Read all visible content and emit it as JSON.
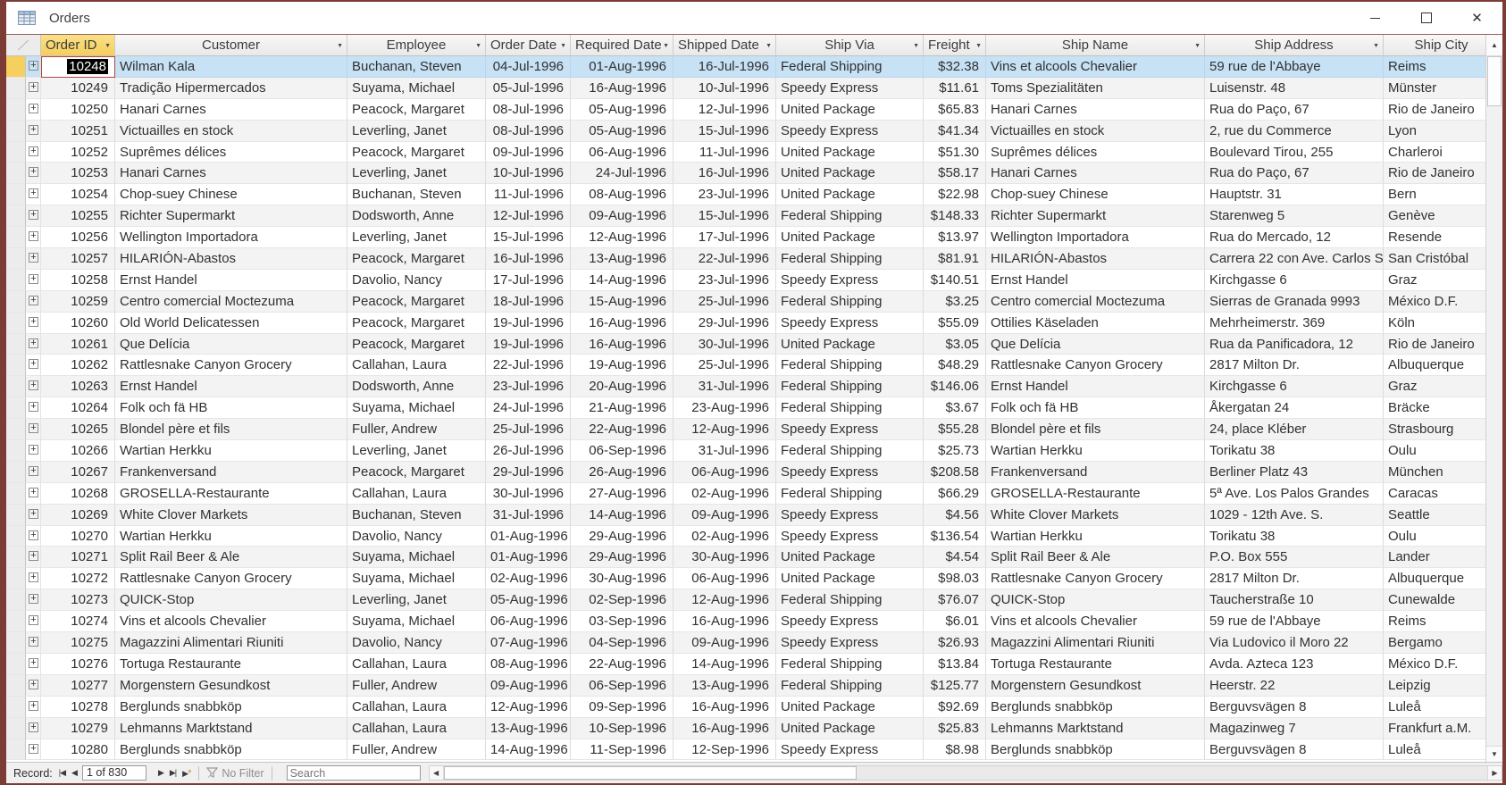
{
  "window": {
    "title": "Orders"
  },
  "icons": {
    "close": "✕",
    "scroll_up": "▲",
    "scroll_down": "▼",
    "scroll_left": "◀",
    "scroll_right": "▶",
    "first": "|◀",
    "previous": "◀",
    "next": "▶",
    "last": "▶|",
    "star": "*",
    "expand_row": "+",
    "header_menu_arrow": "▼"
  },
  "navbar": {
    "record_label": "Record:",
    "position": "1 of 830",
    "no_filter_label": "No Filter",
    "search_placeholder": "Search"
  },
  "table": {
    "columns": [
      {
        "key": "order_id",
        "label": "Order ID"
      },
      {
        "key": "customer",
        "label": "Customer"
      },
      {
        "key": "employee",
        "label": "Employee"
      },
      {
        "key": "order_date",
        "label": "Order Date"
      },
      {
        "key": "required_date",
        "label": "Required Date"
      },
      {
        "key": "shipped_date",
        "label": "Shipped Date"
      },
      {
        "key": "ship_via",
        "label": "Ship Via"
      },
      {
        "key": "freight",
        "label": "Freight"
      },
      {
        "key": "ship_name",
        "label": "Ship Name"
      },
      {
        "key": "ship_address",
        "label": "Ship Address"
      },
      {
        "key": "ship_city",
        "label": "Ship City"
      }
    ],
    "selection": {
      "row_index": 0,
      "column": "order_id",
      "value": "10248"
    },
    "rows": [
      [
        "10248",
        "Wilman Kala",
        "Buchanan, Steven",
        "04-Jul-1996",
        "01-Aug-1996",
        "16-Jul-1996",
        "Federal Shipping",
        "$32.38",
        "Vins et alcools Chevalier",
        "59 rue de l'Abbaye",
        "Reims"
      ],
      [
        "10249",
        "Tradição Hipermercados",
        "Suyama, Michael",
        "05-Jul-1996",
        "16-Aug-1996",
        "10-Jul-1996",
        "Speedy Express",
        "$11.61",
        "Toms Spezialitäten",
        "Luisenstr. 48",
        "Münster"
      ],
      [
        "10250",
        "Hanari Carnes",
        "Peacock, Margaret",
        "08-Jul-1996",
        "05-Aug-1996",
        "12-Jul-1996",
        "United Package",
        "$65.83",
        "Hanari Carnes",
        "Rua do Paço, 67",
        "Rio de Janeiro"
      ],
      [
        "10251",
        "Victuailles en stock",
        "Leverling, Janet",
        "08-Jul-1996",
        "05-Aug-1996",
        "15-Jul-1996",
        "Speedy Express",
        "$41.34",
        "Victuailles en stock",
        "2, rue du Commerce",
        "Lyon"
      ],
      [
        "10252",
        "Suprêmes délices",
        "Peacock, Margaret",
        "09-Jul-1996",
        "06-Aug-1996",
        "11-Jul-1996",
        "United Package",
        "$51.30",
        "Suprêmes délices",
        "Boulevard Tirou, 255",
        "Charleroi"
      ],
      [
        "10253",
        "Hanari Carnes",
        "Leverling, Janet",
        "10-Jul-1996",
        "24-Jul-1996",
        "16-Jul-1996",
        "United Package",
        "$58.17",
        "Hanari Carnes",
        "Rua do Paço, 67",
        "Rio de Janeiro"
      ],
      [
        "10254",
        "Chop-suey Chinese",
        "Buchanan, Steven",
        "11-Jul-1996",
        "08-Aug-1996",
        "23-Jul-1996",
        "United Package",
        "$22.98",
        "Chop-suey Chinese",
        "Hauptstr. 31",
        "Bern"
      ],
      [
        "10255",
        "Richter Supermarkt",
        "Dodsworth, Anne",
        "12-Jul-1996",
        "09-Aug-1996",
        "15-Jul-1996",
        "Federal Shipping",
        "$148.33",
        "Richter Supermarkt",
        "Starenweg 5",
        "Genève"
      ],
      [
        "10256",
        "Wellington Importadora",
        "Leverling, Janet",
        "15-Jul-1996",
        "12-Aug-1996",
        "17-Jul-1996",
        "United Package",
        "$13.97",
        "Wellington Importadora",
        "Rua do Mercado, 12",
        "Resende"
      ],
      [
        "10257",
        "HILARIÓN-Abastos",
        "Peacock, Margaret",
        "16-Jul-1996",
        "13-Aug-1996",
        "22-Jul-1996",
        "Federal Shipping",
        "$81.91",
        "HILARIÓN-Abastos",
        "Carrera 22 con Ave. Carlos S",
        "San Cristóbal"
      ],
      [
        "10258",
        "Ernst Handel",
        "Davolio, Nancy",
        "17-Jul-1996",
        "14-Aug-1996",
        "23-Jul-1996",
        "Speedy Express",
        "$140.51",
        "Ernst Handel",
        "Kirchgasse 6",
        "Graz"
      ],
      [
        "10259",
        "Centro comercial Moctezuma",
        "Peacock, Margaret",
        "18-Jul-1996",
        "15-Aug-1996",
        "25-Jul-1996",
        "Federal Shipping",
        "$3.25",
        "Centro comercial Moctezuma",
        "Sierras de Granada 9993",
        "México D.F."
      ],
      [
        "10260",
        "Old World Delicatessen",
        "Peacock, Margaret",
        "19-Jul-1996",
        "16-Aug-1996",
        "29-Jul-1996",
        "Speedy Express",
        "$55.09",
        "Ottilies Käseladen",
        "Mehrheimerstr. 369",
        "Köln"
      ],
      [
        "10261",
        "Que Delícia",
        "Peacock, Margaret",
        "19-Jul-1996",
        "16-Aug-1996",
        "30-Jul-1996",
        "United Package",
        "$3.05",
        "Que Delícia",
        "Rua da Panificadora, 12",
        "Rio de Janeiro"
      ],
      [
        "10262",
        "Rattlesnake Canyon Grocery",
        "Callahan, Laura",
        "22-Jul-1996",
        "19-Aug-1996",
        "25-Jul-1996",
        "Federal Shipping",
        "$48.29",
        "Rattlesnake Canyon Grocery",
        "2817 Milton Dr.",
        "Albuquerque"
      ],
      [
        "10263",
        "Ernst Handel",
        "Dodsworth, Anne",
        "23-Jul-1996",
        "20-Aug-1996",
        "31-Jul-1996",
        "Federal Shipping",
        "$146.06",
        "Ernst Handel",
        "Kirchgasse 6",
        "Graz"
      ],
      [
        "10264",
        "Folk och fä HB",
        "Suyama, Michael",
        "24-Jul-1996",
        "21-Aug-1996",
        "23-Aug-1996",
        "Federal Shipping",
        "$3.67",
        "Folk och fä HB",
        "Åkergatan 24",
        "Bräcke"
      ],
      [
        "10265",
        "Blondel père et fils",
        "Fuller, Andrew",
        "25-Jul-1996",
        "22-Aug-1996",
        "12-Aug-1996",
        "Speedy Express",
        "$55.28",
        "Blondel père et fils",
        "24, place Kléber",
        "Strasbourg"
      ],
      [
        "10266",
        "Wartian Herkku",
        "Leverling, Janet",
        "26-Jul-1996",
        "06-Sep-1996",
        "31-Jul-1996",
        "Federal Shipping",
        "$25.73",
        "Wartian Herkku",
        "Torikatu 38",
        "Oulu"
      ],
      [
        "10267",
        "Frankenversand",
        "Peacock, Margaret",
        "29-Jul-1996",
        "26-Aug-1996",
        "06-Aug-1996",
        "Speedy Express",
        "$208.58",
        "Frankenversand",
        "Berliner Platz 43",
        "München"
      ],
      [
        "10268",
        "GROSELLA-Restaurante",
        "Callahan, Laura",
        "30-Jul-1996",
        "27-Aug-1996",
        "02-Aug-1996",
        "Federal Shipping",
        "$66.29",
        "GROSELLA-Restaurante",
        "5ª Ave. Los Palos Grandes",
        "Caracas"
      ],
      [
        "10269",
        "White Clover Markets",
        "Buchanan, Steven",
        "31-Jul-1996",
        "14-Aug-1996",
        "09-Aug-1996",
        "Speedy Express",
        "$4.56",
        "White Clover Markets",
        "1029 - 12th Ave. S.",
        "Seattle"
      ],
      [
        "10270",
        "Wartian Herkku",
        "Davolio, Nancy",
        "01-Aug-1996",
        "29-Aug-1996",
        "02-Aug-1996",
        "Speedy Express",
        "$136.54",
        "Wartian Herkku",
        "Torikatu 38",
        "Oulu"
      ],
      [
        "10271",
        "Split Rail Beer & Ale",
        "Suyama, Michael",
        "01-Aug-1996",
        "29-Aug-1996",
        "30-Aug-1996",
        "United Package",
        "$4.54",
        "Split Rail Beer & Ale",
        "P.O. Box 555",
        "Lander"
      ],
      [
        "10272",
        "Rattlesnake Canyon Grocery",
        "Suyama, Michael",
        "02-Aug-1996",
        "30-Aug-1996",
        "06-Aug-1996",
        "United Package",
        "$98.03",
        "Rattlesnake Canyon Grocery",
        "2817 Milton Dr.",
        "Albuquerque"
      ],
      [
        "10273",
        "QUICK-Stop",
        "Leverling, Janet",
        "05-Aug-1996",
        "02-Sep-1996",
        "12-Aug-1996",
        "Federal Shipping",
        "$76.07",
        "QUICK-Stop",
        "Taucherstraße 10",
        "Cunewalde"
      ],
      [
        "10274",
        "Vins et alcools Chevalier",
        "Suyama, Michael",
        "06-Aug-1996",
        "03-Sep-1996",
        "16-Aug-1996",
        "Speedy Express",
        "$6.01",
        "Vins et alcools Chevalier",
        "59 rue de l'Abbaye",
        "Reims"
      ],
      [
        "10275",
        "Magazzini Alimentari Riuniti",
        "Davolio, Nancy",
        "07-Aug-1996",
        "04-Sep-1996",
        "09-Aug-1996",
        "Speedy Express",
        "$26.93",
        "Magazzini Alimentari Riuniti",
        "Via Ludovico il Moro 22",
        "Bergamo"
      ],
      [
        "10276",
        "Tortuga Restaurante",
        "Callahan, Laura",
        "08-Aug-1996",
        "22-Aug-1996",
        "14-Aug-1996",
        "Federal Shipping",
        "$13.84",
        "Tortuga Restaurante",
        "Avda. Azteca 123",
        "México D.F."
      ],
      [
        "10277",
        "Morgenstern Gesundkost",
        "Fuller, Andrew",
        "09-Aug-1996",
        "06-Sep-1996",
        "13-Aug-1996",
        "Federal Shipping",
        "$125.77",
        "Morgenstern Gesundkost",
        "Heerstr. 22",
        "Leipzig"
      ],
      [
        "10278",
        "Berglunds snabbköp",
        "Callahan, Laura",
        "12-Aug-1996",
        "09-Sep-1996",
        "16-Aug-1996",
        "United Package",
        "$92.69",
        "Berglunds snabbköp",
        "Berguvsvägen  8",
        "Luleå"
      ],
      [
        "10279",
        "Lehmanns Marktstand",
        "Callahan, Laura",
        "13-Aug-1996",
        "10-Sep-1996",
        "16-Aug-1996",
        "United Package",
        "$25.83",
        "Lehmanns Marktstand",
        "Magazinweg 7",
        "Frankfurt a.M."
      ],
      [
        "10280",
        "Berglunds snabbköp",
        "Fuller, Andrew",
        "14-Aug-1996",
        "11-Sep-1996",
        "12-Sep-1996",
        "Speedy Express",
        "$8.98",
        "Berglunds snabbköp",
        "Berguvsvägen  8",
        "Luleå"
      ]
    ]
  },
  "colors": {
    "window_border": "#7d3b36",
    "selected_row": "#c7e1f5",
    "selected_header": "#f5cf5c",
    "selected_row_marker": "#f5d05e",
    "alt_row": "#f3f3f3",
    "current_cell_border": "#b3443c",
    "current_cell_highlight": "#000000"
  }
}
